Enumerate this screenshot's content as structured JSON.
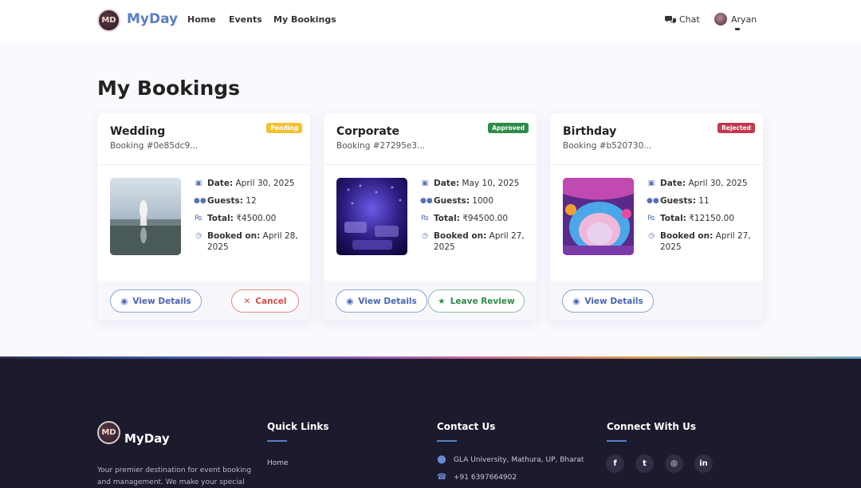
{
  "nav": {
    "brand": "MyDay",
    "logo_text": "MD",
    "links": [
      "Home",
      "Events",
      "My Bookings"
    ],
    "chat_label": "Chat",
    "user_name": "Aryan"
  },
  "page": {
    "title": "My Bookings"
  },
  "bookings": [
    {
      "title": "Wedding",
      "booking_id": "Booking #0e85dc9...",
      "status": "Pending",
      "status_color": "#f2c230",
      "date_label": "Date:",
      "date": "April 30, 2025",
      "guests_label": "Guests:",
      "guests": "12",
      "total_label": "Total:",
      "total": "₹4500.00",
      "booked_label": "Booked on:",
      "booked_on": "April 28, 2025",
      "actions": [
        "View Details",
        "Cancel"
      ]
    },
    {
      "title": "Corporate",
      "booking_id": "Booking #27295e3...",
      "status": "Approved",
      "status_color": "#2e8b4a",
      "date_label": "Date:",
      "date": "May 10, 2025",
      "guests_label": "Guests:",
      "guests": "1000",
      "total_label": "Total:",
      "total": "₹94500.00",
      "booked_label": "Booked on:",
      "booked_on": "April 27, 2025",
      "actions": [
        "View Details",
        "Leave Review"
      ]
    },
    {
      "title": "Birthday",
      "booking_id": "Booking #b520730...",
      "status": "Rejected",
      "status_color": "#c0394a",
      "date_label": "Date:",
      "date": "April 30, 2025",
      "guests_label": "Guests:",
      "guests": "11",
      "total_label": "Total:",
      "total": "₹12150.00",
      "booked_label": "Booked on:",
      "booked_on": "April 27, 2025",
      "actions": [
        "View Details"
      ]
    }
  ],
  "footer": {
    "brand": "MyDay",
    "description": "Your premier destination for event booking and management. We make your special",
    "quick_links_heading": "Quick Links",
    "quick_links": [
      "Home"
    ],
    "contact_heading": "Contact Us",
    "address": "GLA University, Mathura, UP, Bharat",
    "phone": "+91 6397664902",
    "connect_heading": "Connect With Us",
    "social_icons": [
      "facebook-icon",
      "twitter-icon",
      "instagram-icon",
      "linkedin-icon"
    ]
  },
  "colors": {
    "brand_blue": "#5a7ec4",
    "footer_bg": "#1c1b2e",
    "page_bg": "#faf9fe"
  }
}
